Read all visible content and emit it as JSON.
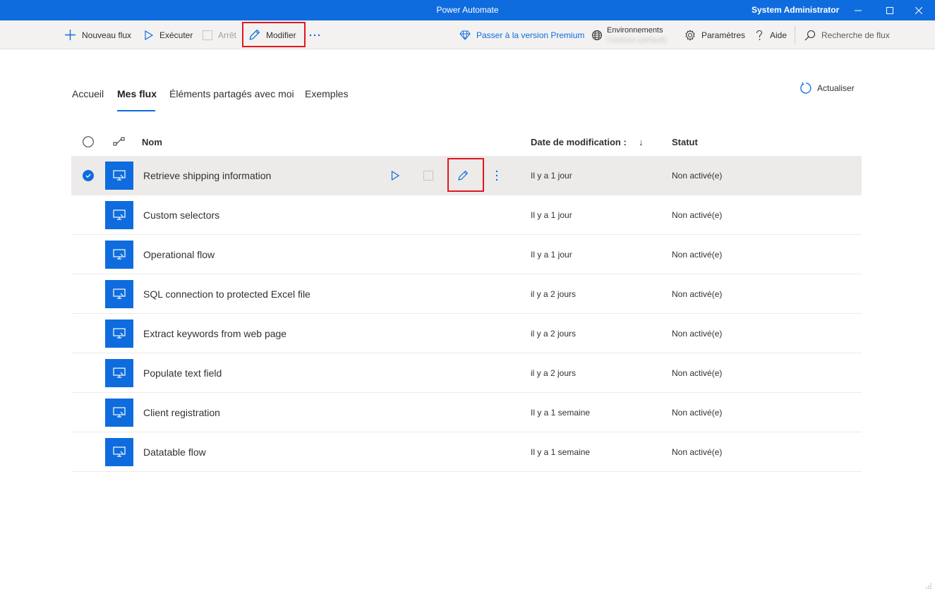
{
  "window": {
    "title": "Power Automate",
    "user": "System Administrator",
    "controls": [
      "minimize-icon",
      "maximize-icon",
      "close-icon"
    ]
  },
  "toolbar": {
    "new_flow": "Nouveau flux",
    "run": "Exécuter",
    "stop": "Arrêt",
    "edit": "Modifier",
    "premium": "Passer à la version Premium",
    "environments_label": "Environnements",
    "environment_value": "Contoso (default)",
    "settings": "Paramètres",
    "help": "Aide",
    "search_placeholder": "Recherche de flux"
  },
  "tabs": [
    {
      "label": "Accueil",
      "active": false
    },
    {
      "label": "Mes flux",
      "active": true
    },
    {
      "label": "Éléments partagés avec moi",
      "active": false
    },
    {
      "label": "Exemples",
      "active": false
    }
  ],
  "refresh_label": "Actualiser",
  "table": {
    "columns": {
      "name": "Nom",
      "modified": "Date de modification :",
      "modified_sort": "↓",
      "status": "Statut"
    },
    "rows": [
      {
        "name": "Retrieve shipping information",
        "modified": "Il y a 1 jour",
        "status": "Non activé(e)",
        "selected": true
      },
      {
        "name": "Custom selectors",
        "modified": "Il y a 1 jour",
        "status": "Non activé(e)",
        "selected": false
      },
      {
        "name": "Operational flow",
        "modified": "Il y a 1 jour",
        "status": "Non activé(e)",
        "selected": false
      },
      {
        "name": "SQL connection to protected Excel file",
        "modified": "il y a 2 jours",
        "status": "Non activé(e)",
        "selected": false
      },
      {
        "name": "Extract keywords from web page",
        "modified": "il y a 2 jours",
        "status": "Non activé(e)",
        "selected": false
      },
      {
        "name": "Populate text field",
        "modified": "il y a 2 jours",
        "status": "Non activé(e)",
        "selected": false
      },
      {
        "name": "Client registration",
        "modified": "Il y a 1 semaine",
        "status": "Non activé(e)",
        "selected": false
      },
      {
        "name": "Datatable flow",
        "modified": "Il y a 1 semaine",
        "status": "Non activé(e)",
        "selected": false
      }
    ]
  },
  "colors": {
    "accent": "#0f6cde",
    "highlight": "#e3161d",
    "selected_row": "#edebe9",
    "toolbar_bg": "#f3f2f1"
  }
}
